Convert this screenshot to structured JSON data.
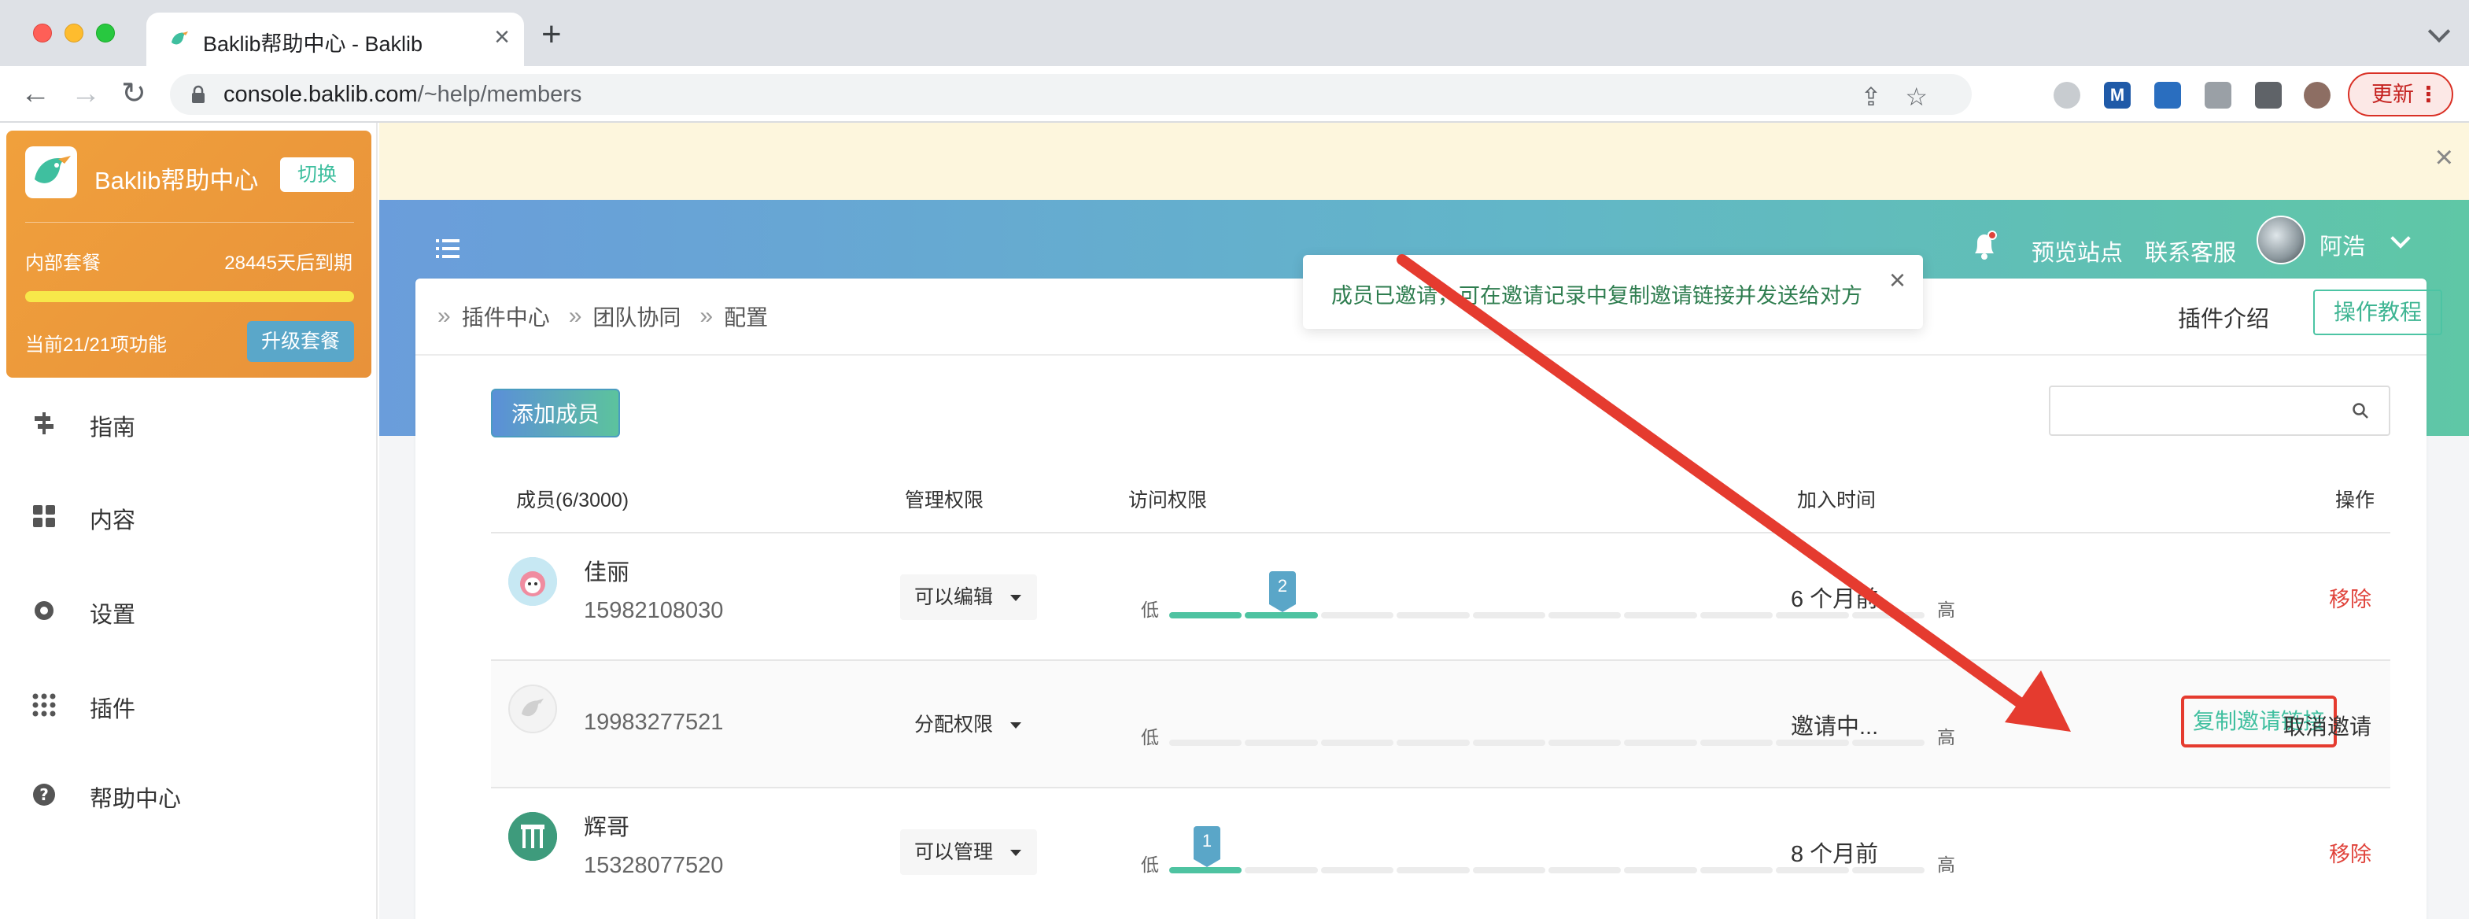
{
  "browser": {
    "tab_title": "Baklib帮助中心 - Baklib",
    "url_host": "console.baklib.com",
    "url_path": "/~help/members",
    "update_label": "更新"
  },
  "sidebar": {
    "brand_name": "Baklib帮助中心",
    "switch_label": "切换",
    "plan_name": "内部套餐",
    "plan_days": "28445天后到期",
    "plan_features": "当前21/21项功能",
    "plan_progress": 1.0,
    "upgrade_label": "升级套餐",
    "menu": [
      {
        "label": "指南",
        "icon": "signpost-icon"
      },
      {
        "label": "内容",
        "icon": "grid-icon"
      },
      {
        "label": "设置",
        "icon": "gear-icon"
      },
      {
        "label": "插件",
        "icon": "dots-grid-icon"
      },
      {
        "label": "帮助中心",
        "icon": "question-icon"
      }
    ]
  },
  "header": {
    "preview_site": "预览站点",
    "contact_support": "联系客服",
    "user_name": "阿浩"
  },
  "toast": {
    "message": "成员已邀请，可在邀请记录中复制邀请链接并发送给对方"
  },
  "breadcrumb": [
    "插件中心",
    "团队协同",
    "配置"
  ],
  "page_actions": {
    "plugin_intro": "插件介绍",
    "tutorial": "操作教程",
    "add_member": "添加成员"
  },
  "table": {
    "headers": {
      "member": "成员(6/3000)",
      "admin_perm": "管理权限",
      "access_perm": "访问权限",
      "joined": "加入时间",
      "actions": "操作"
    },
    "level_low": "低",
    "level_high": "高",
    "rows": [
      {
        "name": "佳丽",
        "phone": "15982108030",
        "admin_perm": "可以编辑",
        "access_level": 2,
        "access_level_label": "2",
        "joined": "6 个月前",
        "action": "移除"
      },
      {
        "name": "",
        "phone": "19983277521",
        "admin_perm": "分配权限",
        "access_level": 0,
        "joined": "邀请中...",
        "copy_link": "复制邀请链接",
        "cancel_invite": "取消邀请"
      },
      {
        "name": "辉哥",
        "phone": "15328077520",
        "admin_perm": "可以管理",
        "access_level": 1,
        "access_level_label": "1",
        "joined": "8 个月前",
        "action": "移除"
      }
    ]
  },
  "colors": {
    "accent_green": "#4ec3a1",
    "danger_red": "#e0433b",
    "annotation_red": "#e53b2f"
  }
}
